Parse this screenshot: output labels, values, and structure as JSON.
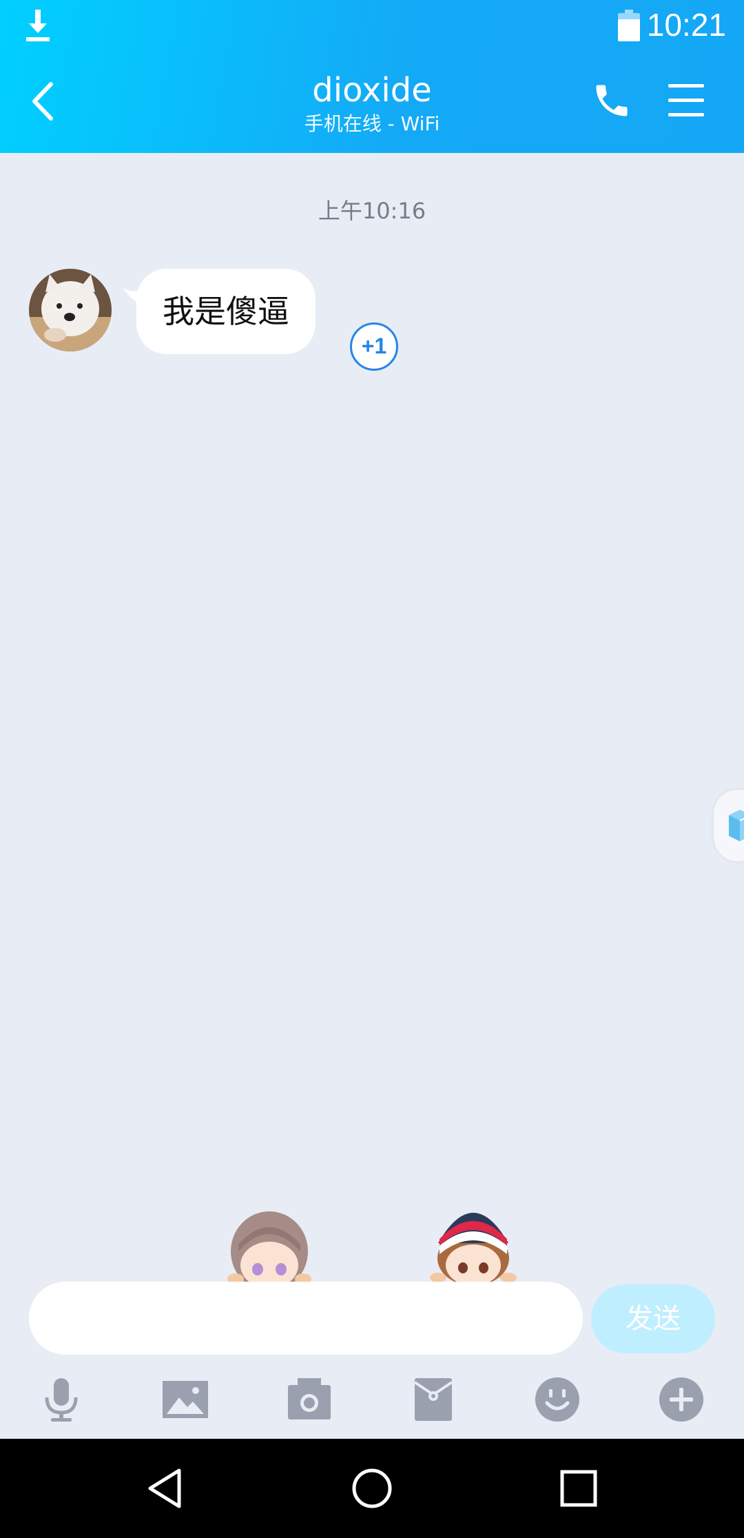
{
  "status_bar": {
    "time": "10:21"
  },
  "header": {
    "title": "dioxide",
    "subtitle": "手机在线 - WiFi"
  },
  "chat": {
    "timestamp": "上午10:16",
    "messages": [
      {
        "text": "我是傻逼",
        "plus_one": "+1"
      }
    ]
  },
  "composer": {
    "input_value": "",
    "input_placeholder": "",
    "send_label": "发送"
  },
  "toolbar": {
    "icons": [
      "microphone-icon",
      "image-icon",
      "camera-icon",
      "red-packet-icon",
      "emoji-icon",
      "plus-icon"
    ]
  },
  "colors": {
    "header_gradient_start": "#00d0ff",
    "header_gradient_end": "#14a7f5",
    "chat_background": "#e8ecf5",
    "toolbar_icon": "#9aa0ae",
    "plus_one_accent": "#2486e6",
    "send_button": "#bfeeff"
  }
}
